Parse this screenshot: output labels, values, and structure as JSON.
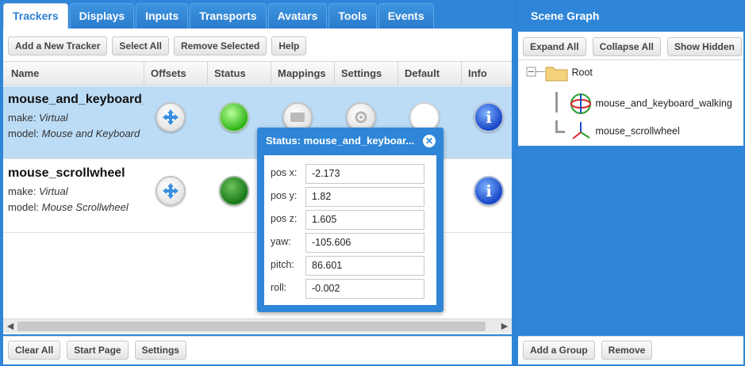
{
  "tabs": [
    "Trackers",
    "Displays",
    "Inputs",
    "Transports",
    "Avatars",
    "Tools",
    "Events"
  ],
  "toolbar": {
    "add_tracker": "Add a New Tracker",
    "select_all": "Select All",
    "remove_selected": "Remove Selected",
    "help": "Help"
  },
  "columns": [
    "Name",
    "Offsets",
    "Status",
    "Mappings",
    "Settings",
    "Default",
    "Info"
  ],
  "trackers": [
    {
      "name": "mouse_and_keyboard_walking",
      "make_label": "make:",
      "make": "Virtual",
      "model_label": "model:",
      "model": "Mouse and Keyboard Walking",
      "status_color": "#2fb417"
    },
    {
      "name": "mouse_scrollwheel",
      "make_label": "make:",
      "make": "Virtual",
      "model_label": "model:",
      "model": "Mouse Scrollwheel",
      "status_color": "#18781a"
    }
  ],
  "footer": {
    "clear_all": "Clear All",
    "start_page": "Start Page",
    "settings": "Settings"
  },
  "scene_graph": {
    "title": "Scene Graph",
    "expand_all": "Expand All",
    "collapse_all": "Collapse All",
    "show_hidden": "Show Hidden",
    "root": "Root",
    "children": [
      "mouse_and_keyboard_walking",
      "mouse_scrollwheel"
    ],
    "add_group": "Add a Group",
    "remove": "Remove"
  },
  "status_popup": {
    "title": "Status: mouse_and_keyboar...",
    "fields": [
      {
        "label": "pos x:",
        "value": "-2.173"
      },
      {
        "label": "pos y:",
        "value": "1.82"
      },
      {
        "label": "pos z:",
        "value": "1.605"
      },
      {
        "label": "yaw:",
        "value": "-105.606"
      },
      {
        "label": "pitch:",
        "value": "86.601"
      },
      {
        "label": "roll:",
        "value": "-0.002"
      }
    ]
  },
  "colors": {
    "accent": "#2f86d8",
    "selected_row": "#bcdcf6"
  }
}
